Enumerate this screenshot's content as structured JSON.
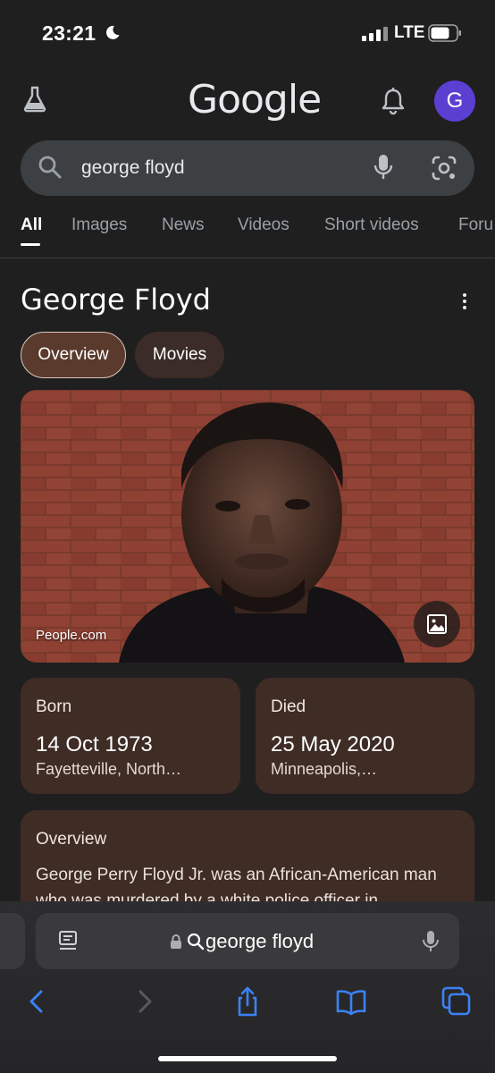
{
  "status_bar": {
    "time": "23:21",
    "network": "LTE",
    "icons": [
      "moon-icon",
      "signal-icon",
      "battery-icon"
    ]
  },
  "header": {
    "logo": "Google",
    "avatar_letter": "G",
    "icons": [
      "flask-icon",
      "bell-icon"
    ]
  },
  "search": {
    "query": "george floyd",
    "icons": [
      "search-icon",
      "mic-icon",
      "lens-icon"
    ]
  },
  "tabs": [
    {
      "label": "All",
      "active": true
    },
    {
      "label": "Images"
    },
    {
      "label": "News"
    },
    {
      "label": "Videos"
    },
    {
      "label": "Short videos"
    },
    {
      "label": "Foru"
    }
  ],
  "knowledge_panel": {
    "title": "George Floyd",
    "chips": [
      "Overview",
      "Movies"
    ],
    "photo_credit": "People.com",
    "born": {
      "label": "Born",
      "date": "14 Oct 1973",
      "place": "Fayetteville, North…"
    },
    "died": {
      "label": "Died",
      "date": "25 May 2020",
      "place": "Minneapolis,…"
    },
    "overview": {
      "title": "Overview",
      "text": "George Perry Floyd Jr. was an African-American man who was murdered by a white police officer in"
    }
  },
  "safari": {
    "url_text": "george floyd",
    "icons": [
      "reader-icon",
      "lock-icon",
      "back-icon",
      "forward-icon",
      "share-icon",
      "bookmarks-icon",
      "tabs-icon"
    ]
  },
  "colors": {
    "background": "#1f1f1f",
    "search_box": "#3c4043",
    "card": "#3e2c25",
    "chip_active": "#5a3a2c",
    "avatar": "#5b3fd1",
    "safari_accent": "#3b82f6"
  }
}
